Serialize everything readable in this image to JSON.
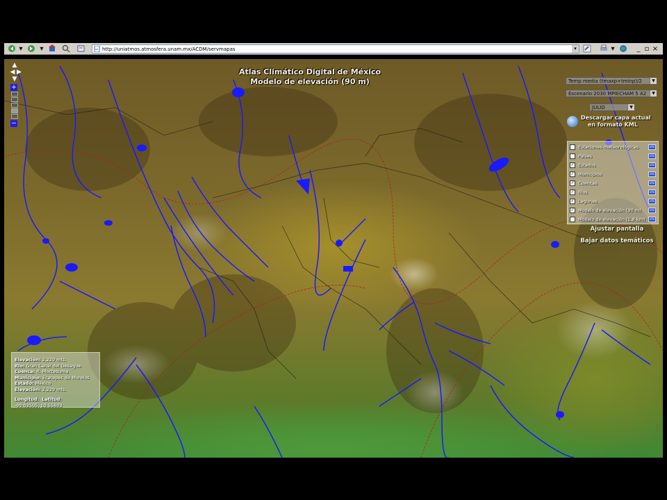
{
  "browser": {
    "url": "http://uniatmos.atmosfera.unam.mx/ACDM/servmapas"
  },
  "map": {
    "title_line1": "Atlas Climático Digital de México",
    "title_line2": "Modelo de elevación  (90 m)",
    "variable_select": "Temp media (tmaxp+tminp)/2",
    "scenario_select": "Escenario 2030 MPIECHAM 5 A2",
    "month_select": "JULIO",
    "kml_link_line1": "Descargar capa actual",
    "kml_link_line2": "en formato KML",
    "layers": [
      {
        "label": "Estaciones meteorológicas",
        "checked": false
      },
      {
        "label": "Países",
        "checked": false
      },
      {
        "label": "Estados",
        "checked": true
      },
      {
        "label": "Municipios",
        "checked": true
      },
      {
        "label": "Cuencas",
        "checked": true
      },
      {
        "label": "Ríos",
        "checked": true
      },
      {
        "label": "Lagunas",
        "checked": true
      },
      {
        "label": "Modelo de elevación (90 m)",
        "checked": true
      },
      {
        "label": "Modelo de elevación (1.8 km)",
        "checked": false
      }
    ],
    "info_icon": "info-icon",
    "adjust_screen": "Ajustar pantalla",
    "download_data": "Bajar datos temáticos",
    "info": {
      "elevation_label": "Elevación:",
      "elevation_value": "2,229 mts.",
      "river_label": "Río:",
      "river_value": "Gran Canal del Desague",
      "basin_label": "Cuenca:",
      "basin_value": "R. Moctezuma",
      "municipality_label": "Municipio:",
      "municipality_value": "Ecatepec de Morelos",
      "state_label": "Estado:",
      "state_value": "México",
      "elevation2_label": "Elevación:",
      "elevation2_value": "2,229 mts.",
      "lon_label": "Longitud:",
      "lat_label": "Latitud:",
      "coords_value": "-99.02505, 19.55603"
    }
  },
  "colors": {
    "rivers": "#1a1aff",
    "municipal_borders": "#1a1a1a",
    "state_borders": "#b02020",
    "toolbar": "#d4d0c8"
  }
}
